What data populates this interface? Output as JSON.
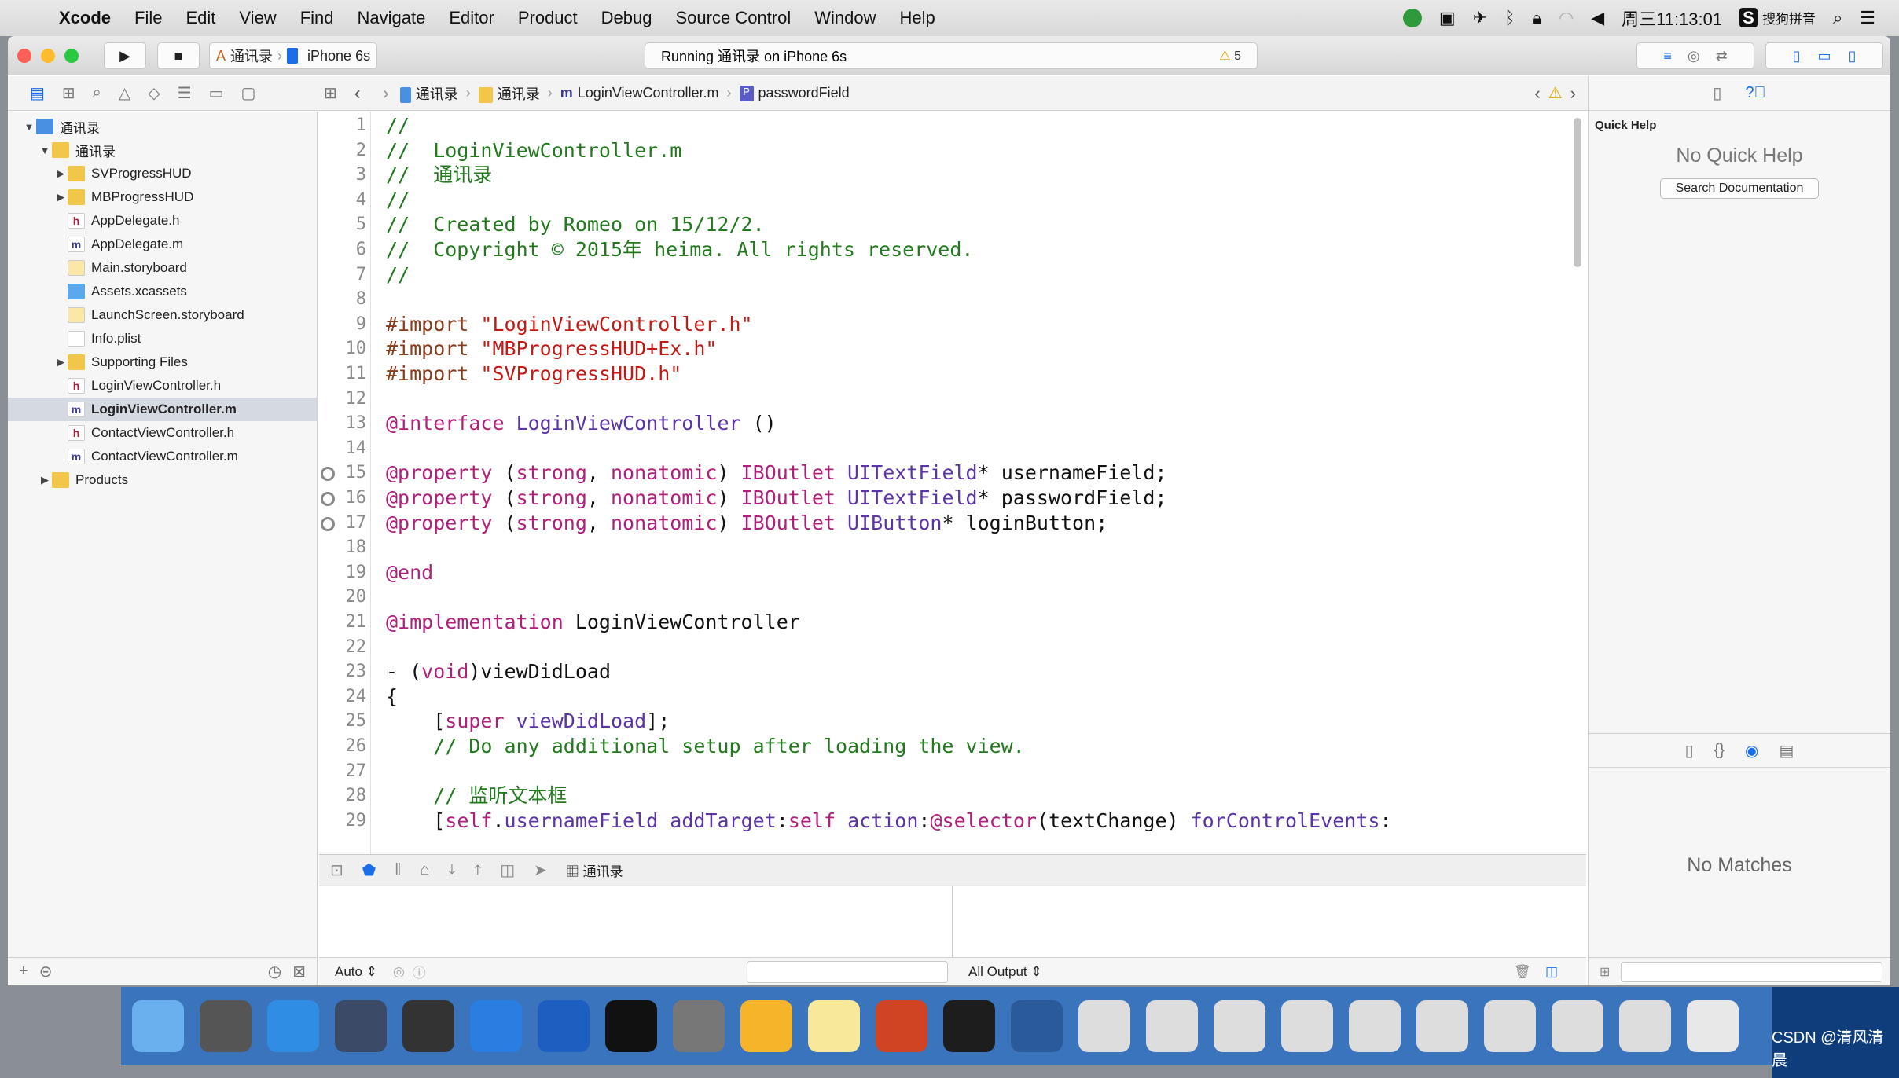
{
  "menubar": {
    "app": "Xcode",
    "items": [
      "File",
      "Edit",
      "View",
      "Find",
      "Navigate",
      "Editor",
      "Product",
      "Debug",
      "Source Control",
      "Window",
      "Help"
    ],
    "clock": "周三11:13:01",
    "ime": "搜狗拼音"
  },
  "toolbar": {
    "scheme": "通讯录",
    "device": "iPhone 6s",
    "status": "Running 通讯录 on iPhone 6s",
    "warnings": "5"
  },
  "jumpbar": {
    "crumbs": [
      "通讯录",
      "通讯录",
      "LoginViewController.m",
      "passwordField"
    ]
  },
  "navigator": {
    "items": [
      {
        "label": "通讯录",
        "depth": 0,
        "kind": "project",
        "open": true
      },
      {
        "label": "通讯录",
        "depth": 1,
        "kind": "folder",
        "open": true
      },
      {
        "label": "SVProgressHUD",
        "depth": 2,
        "kind": "folder",
        "open": false
      },
      {
        "label": "MBProgressHUD",
        "depth": 2,
        "kind": "folder",
        "open": false
      },
      {
        "label": "AppDelegate.h",
        "depth": 2,
        "kind": "h"
      },
      {
        "label": "AppDelegate.m",
        "depth": 2,
        "kind": "m"
      },
      {
        "label": "Main.storyboard",
        "depth": 2,
        "kind": "sb"
      },
      {
        "label": "Assets.xcassets",
        "depth": 2,
        "kind": "assets"
      },
      {
        "label": "LaunchScreen.storyboard",
        "depth": 2,
        "kind": "sb"
      },
      {
        "label": "Info.plist",
        "depth": 2,
        "kind": "plist"
      },
      {
        "label": "Supporting Files",
        "depth": 2,
        "kind": "folder",
        "open": false
      },
      {
        "label": "LoginViewController.h",
        "depth": 2,
        "kind": "h"
      },
      {
        "label": "LoginViewController.m",
        "depth": 2,
        "kind": "m",
        "selected": true
      },
      {
        "label": "ContactViewController.h",
        "depth": 2,
        "kind": "h"
      },
      {
        "label": "ContactViewController.m",
        "depth": 2,
        "kind": "m"
      },
      {
        "label": "Products",
        "depth": 1,
        "kind": "folder",
        "open": false
      }
    ]
  },
  "editor": {
    "lines": [
      [
        [
          "comment",
          "//"
        ]
      ],
      [
        [
          "comment",
          "//  LoginViewController.m"
        ]
      ],
      [
        [
          "comment",
          "//  通讯录"
        ]
      ],
      [
        [
          "comment",
          "//"
        ]
      ],
      [
        [
          "comment",
          "//  Created by Romeo on 15/12/2."
        ]
      ],
      [
        [
          "comment",
          "//  Copyright © 2015年 heima. All rights reserved."
        ]
      ],
      [
        [
          "comment",
          "//"
        ]
      ],
      [],
      [
        [
          "pre",
          "#import "
        ],
        [
          "str",
          "\"LoginViewController.h\""
        ]
      ],
      [
        [
          "pre",
          "#import "
        ],
        [
          "str",
          "\"MBProgressHUD+Ex.h\""
        ]
      ],
      [
        [
          "pre",
          "#import "
        ],
        [
          "str",
          "\"SVProgressHUD.h\""
        ]
      ],
      [],
      [
        [
          "kw",
          "@interface "
        ],
        [
          "cls",
          "LoginViewController"
        ],
        [
          "plain",
          " ()"
        ]
      ],
      [],
      [
        [
          "kw",
          "@property"
        ],
        [
          "plain",
          " ("
        ],
        [
          "kw",
          "strong"
        ],
        [
          "plain",
          ", "
        ],
        [
          "kw",
          "nonatomic"
        ],
        [
          "plain",
          ") "
        ],
        [
          "kw",
          "IBOutlet "
        ],
        [
          "cls",
          "UITextField"
        ],
        [
          "plain",
          "* usernameField;"
        ]
      ],
      [
        [
          "kw",
          "@property"
        ],
        [
          "plain",
          " ("
        ],
        [
          "kw",
          "strong"
        ],
        [
          "plain",
          ", "
        ],
        [
          "kw",
          "nonatomic"
        ],
        [
          "plain",
          ") "
        ],
        [
          "kw",
          "IBOutlet "
        ],
        [
          "cls",
          "UITextField"
        ],
        [
          "plain",
          "* passwordField;"
        ]
      ],
      [
        [
          "kw",
          "@property"
        ],
        [
          "plain",
          " ("
        ],
        [
          "kw",
          "strong"
        ],
        [
          "plain",
          ", "
        ],
        [
          "kw",
          "nonatomic"
        ],
        [
          "plain",
          ") "
        ],
        [
          "kw",
          "IBOutlet "
        ],
        [
          "cls",
          "UIButton"
        ],
        [
          "plain",
          "* loginButton;"
        ]
      ],
      [],
      [
        [
          "kw",
          "@end"
        ]
      ],
      [],
      [
        [
          "kw",
          "@implementation "
        ],
        [
          "plain",
          "LoginViewController"
        ]
      ],
      [],
      [
        [
          "plain",
          "- ("
        ],
        [
          "kw",
          "void"
        ],
        [
          "plain",
          ")viewDidLoad"
        ]
      ],
      [
        [
          "plain",
          "{"
        ]
      ],
      [
        [
          "plain",
          "    ["
        ],
        [
          "kw",
          "super"
        ],
        [
          "cls",
          " viewDidLoad"
        ],
        [
          "plain",
          "];"
        ]
      ],
      [
        [
          "comment",
          "    // Do any additional setup after loading the view."
        ]
      ],
      [],
      [
        [
          "comment",
          "    // 监听文本框"
        ]
      ],
      [
        [
          "plain",
          "    ["
        ],
        [
          "kw",
          "self"
        ],
        [
          "plain",
          "."
        ],
        [
          "cls",
          "usernameField"
        ],
        [
          "plain",
          " "
        ],
        [
          "cls",
          "addTarget"
        ],
        [
          "plain",
          ":"
        ],
        [
          "kw",
          "self"
        ],
        [
          "plain",
          " "
        ],
        [
          "cls",
          "action"
        ],
        [
          "plain",
          ":"
        ],
        [
          "kw",
          "@selector"
        ],
        [
          "plain",
          "(textChange) "
        ],
        [
          "cls",
          "forControlEvents"
        ],
        [
          "plain",
          ":"
        ]
      ]
    ],
    "breakpoint_lines": [
      15,
      16,
      17
    ]
  },
  "debugbar": {
    "target": "通讯录"
  },
  "console": {
    "scope": "Auto ⇕",
    "output": "All Output ⇕"
  },
  "inspector": {
    "title": "Quick Help",
    "empty": "No Quick Help",
    "search_button": "Search Documentation",
    "library_empty": "No Matches"
  },
  "watermark": "CSDN @清风清晨",
  "colors": {
    "comment": "#237a1e",
    "keyword": "#b0207a",
    "class": "#5b34a6",
    "string": "#c41a16",
    "accent": "#1c6ee8"
  }
}
